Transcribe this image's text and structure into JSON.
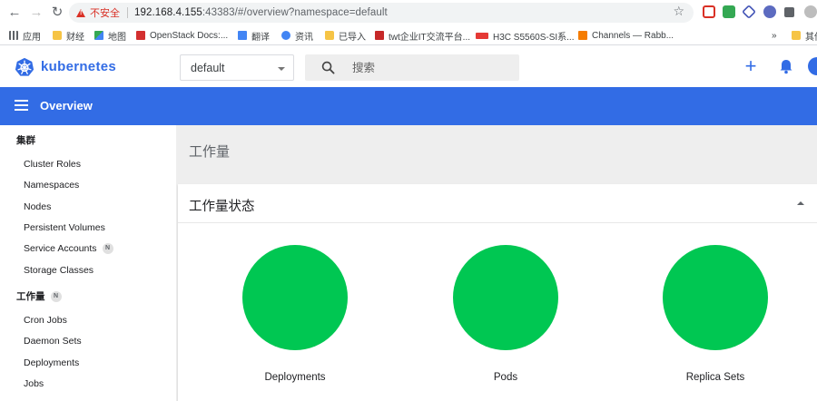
{
  "browser": {
    "insecure_label": "不安全",
    "url_host": "192.168.4.155",
    "url_rest": ":43383/#/overview?namespace=default",
    "bookmarks": [
      {
        "label": "应用",
        "icon": "apps-grid-icon"
      },
      {
        "label": "财经",
        "icon": "folder-icon"
      },
      {
        "label": "地图",
        "icon": "maps-icon"
      },
      {
        "label": "OpenStack Docs:...",
        "icon": "openstack-icon"
      },
      {
        "label": "翻译",
        "icon": "translate-icon"
      },
      {
        "label": "资讯",
        "icon": "news-icon"
      },
      {
        "label": "已导入",
        "icon": "folder-icon"
      },
      {
        "label": "twt企业IT交流平台...",
        "icon": "twt-icon"
      },
      {
        "label": "H3C S5560S-SI系...",
        "icon": "h3c-icon"
      },
      {
        "label": "Channels — Rabb...",
        "icon": "rabbitmq-icon"
      },
      {
        "label": "»",
        "icon": "more-bookmarks-icon"
      },
      {
        "label": "其他",
        "icon": "folder-icon"
      }
    ]
  },
  "header": {
    "brand": "kubernetes",
    "namespace": "default",
    "search_placeholder": "搜索",
    "brand_color": "#326ce5"
  },
  "toolbar": {
    "title": "Overview"
  },
  "sidebar": {
    "cluster_heading": "集群",
    "cluster_items": [
      "Cluster Roles",
      "Namespaces",
      "Nodes",
      "Persistent Volumes",
      "Service Accounts",
      "Storage Classes"
    ],
    "service_accounts_badge": "N",
    "workloads_heading": "工作量",
    "workloads_badge": "N",
    "workload_items": [
      "Cron Jobs",
      "Daemon Sets",
      "Deployments",
      "Jobs"
    ]
  },
  "main": {
    "page_title": "工作量",
    "card_title": "工作量状态",
    "status_color": "#00c752",
    "charts": [
      {
        "label": "Deployments",
        "running_fraction": 1.0
      },
      {
        "label": "Pods",
        "running_fraction": 1.0
      },
      {
        "label": "Replica Sets",
        "running_fraction": 1.0
      }
    ]
  }
}
